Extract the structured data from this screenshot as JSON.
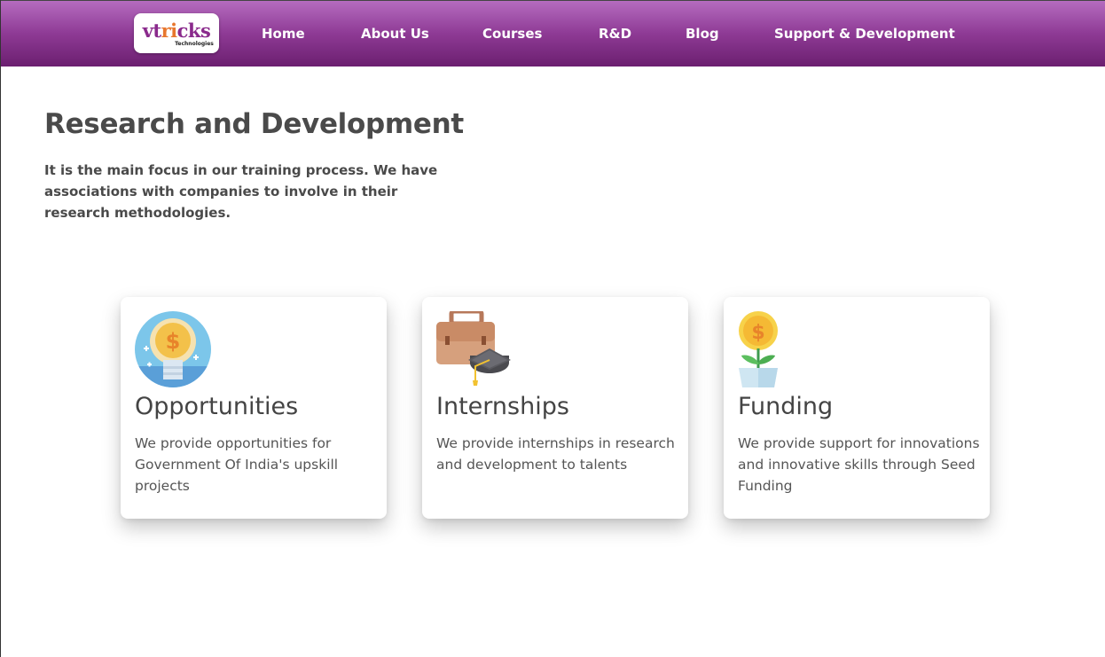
{
  "header": {
    "logo": {
      "text_part1": "vt",
      "text_part2": "ri",
      "text_part3": "cks",
      "subtitle": "Technologies"
    },
    "nav": [
      {
        "label": "Home"
      },
      {
        "label": "About Us"
      },
      {
        "label": "Courses"
      },
      {
        "label": "R&D"
      },
      {
        "label": "Blog"
      },
      {
        "label": "Support & Development"
      }
    ],
    "colors": {
      "gradient_top": "#b56cbf",
      "gradient_bottom": "#6b1f70"
    }
  },
  "main": {
    "title": "Research and Development",
    "intro": "It is the main focus in our training process. We have associations with companies to involve in their research methodologies.",
    "cards": [
      {
        "icon": "lightbulb-dollar-icon",
        "title": "Opportunities",
        "text": "We provide opportunities for Government Of India's upskill projects"
      },
      {
        "icon": "briefcase-graduation-icon",
        "title": "Internships",
        "text": "We provide internships in research and development to talents"
      },
      {
        "icon": "money-plant-icon",
        "title": "Funding",
        "text": "We provide support for innovations and innovative skills through Seed Funding"
      }
    ]
  }
}
